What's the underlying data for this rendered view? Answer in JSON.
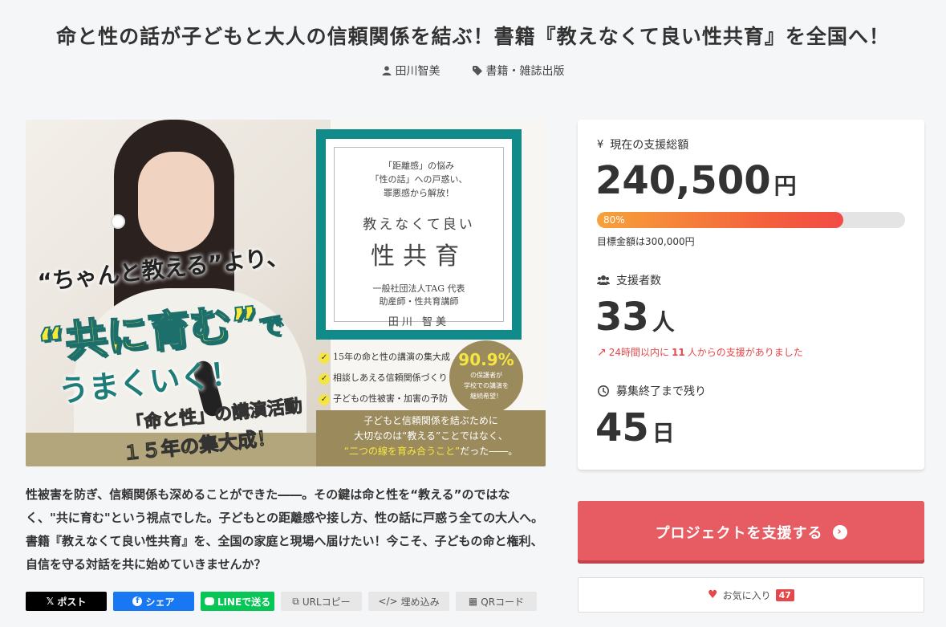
{
  "project": {
    "title": "命と性の話が子どもと大人の信頼関係を結ぶ！書籍『教えなくて良い性共育』を全国へ！",
    "author": "田川智美",
    "category": "書籍・雑誌出版"
  },
  "hero": {
    "line1": "“ちゃんと教える”より、",
    "line2": "“共に育む”",
    "line2_suffix": "で",
    "line3": "うまくいく！",
    "line4": "「命と性」の講演活動",
    "line5": "１５年の集大成！",
    "book": {
      "sub1": "「距離感」の悩み",
      "sub2": "「性の話」への戸惑い、",
      "sub3": "罪悪感から解放！",
      "title1": "教えなくて良い",
      "title2": "性共育",
      "org1": "一般社団法人TAG 代表",
      "org2": "助産師・性共育講師",
      "author": "田川 智美"
    },
    "checks": [
      "15年の命と性の講演の集大成",
      "相談しあえる信頼関係づくり",
      "子どもの性被害・加害の予防"
    ],
    "badge_pct": "90.9%",
    "badge_text1": "の保護者が",
    "badge_text2": "学校での講演を",
    "badge_text3": "継続希望！",
    "bottom1": "子どもと信頼関係を結ぶために",
    "bottom2": "大切なのは“教える”ことではなく、",
    "bottom3": "“二つの線を育み合うこと”",
    "bottom3_suffix": "だった――。"
  },
  "description": "性被害を防ぎ、信頼関係も深めることができた――。その鍵は命と性を“教える”のではなく、\"共に育む\"という視点でした。子どもとの距離感や接し方、性の話に戸惑う全ての大人へ。書籍『教えなくて良い性共育』を、全国の家庭と現場へ届けたい！今こそ、子どもの命と権利、自信を守る対話を共に始めていきませんか？",
  "share": {
    "x": "ポスト",
    "facebook": "シェア",
    "line": "LINEで送る",
    "url_copy": "URLコピー",
    "embed": "埋め込み",
    "qr": "QRコード"
  },
  "stats": {
    "amount_label": "現在の支援総額",
    "amount": "240,500",
    "amount_unit": "円",
    "progress_label": "80%",
    "progress_percent": 80,
    "goal": "目標金額は300,000円",
    "supporters_label": "支援者数",
    "supporters": "33",
    "supporters_unit": "人",
    "recent_prefix": "24時間以内に",
    "recent_count": "11",
    "recent_suffix": "人からの支援がありました",
    "remaining_label": "募集終了まで残り",
    "remaining": "45",
    "remaining_unit": "日"
  },
  "actions": {
    "support_label": "プロジェクトを支援する",
    "favorite_label": "お気に入り",
    "favorite_count": "47"
  },
  "colors": {
    "primary": "#e75b63",
    "accent_red": "#e5474a",
    "teal": "#118a8a"
  }
}
